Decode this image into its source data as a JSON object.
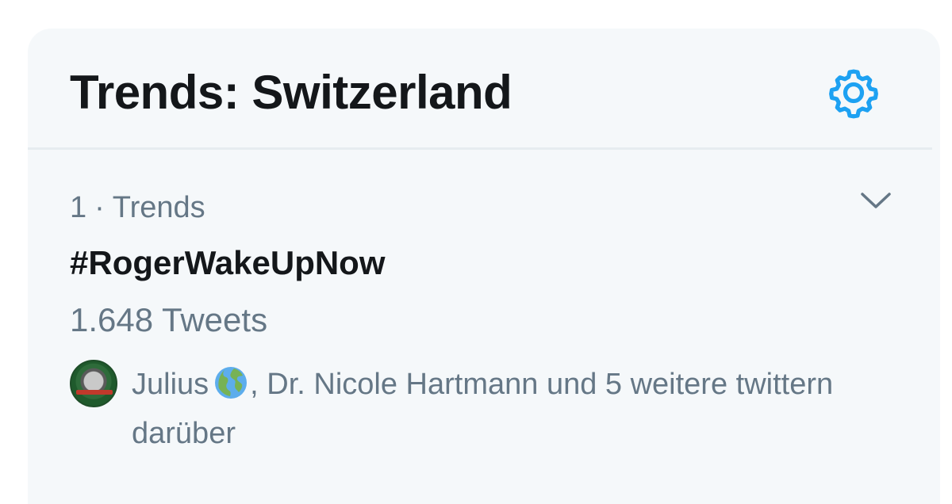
{
  "header": {
    "title": "Trends: Switzerland",
    "settings_icon": "gear-icon",
    "accent_color": "#1da1f2"
  },
  "trend": {
    "rank": "1",
    "separator": "·",
    "category": "Trends",
    "hashtag": "#RogerWakeUpNow",
    "tweet_count": "1.648 Tweets",
    "more_icon": "chevron-down-icon",
    "social_context": {
      "first_user": "Julius",
      "first_user_emoji": "globe-africa-europe-emoji",
      "rest": ", Dr. Nicole Hartmann und 5 weitere twittern darüber"
    }
  },
  "colors": {
    "card_background": "#f5f8fa",
    "primary_text": "#14171a",
    "secondary_text": "#657786",
    "divider": "#e6ecf0"
  }
}
